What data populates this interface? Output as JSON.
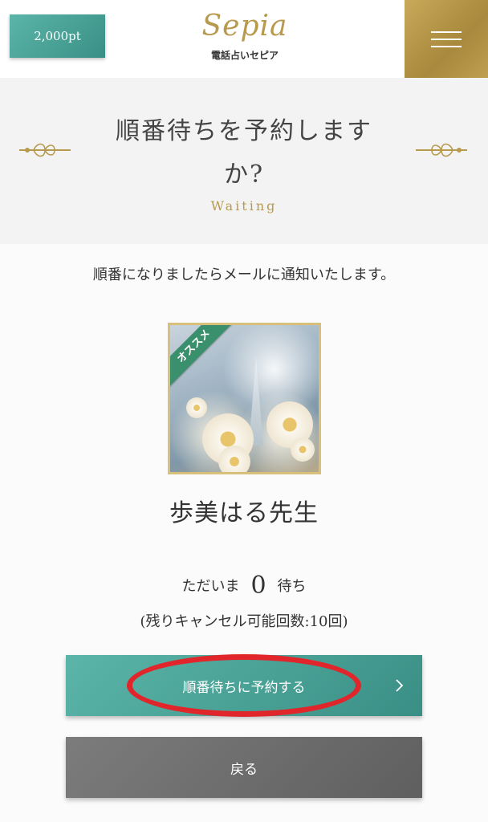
{
  "header": {
    "points_label": "2,000pt",
    "logo_script": "Sepia",
    "logo_sub": "電話占いセピア",
    "menu_icon": "hamburger-menu-icon"
  },
  "title_band": {
    "title": "順番待ちを予約しますか?",
    "subtitle": "Waiting",
    "ornament_icon": "ornament-flourish-icon"
  },
  "main": {
    "notice": "順番になりましたらメールに通知いたします。",
    "avatar": {
      "badge": "オススメ"
    },
    "fortune_teller_name": "歩美はる先生",
    "waiting_prefix": "ただいま",
    "waiting_count": "0",
    "waiting_suffix": "待ち",
    "cancel_info": "(残りキャンセル可能回数:10回)",
    "reserve_button": "順番待ちに予約する",
    "back_button": "戻る"
  },
  "colors": {
    "teal": "#4aa396",
    "gold": "#b89a4e",
    "gray_button": "#6e6e6e",
    "highlight_red": "#e0262b"
  }
}
